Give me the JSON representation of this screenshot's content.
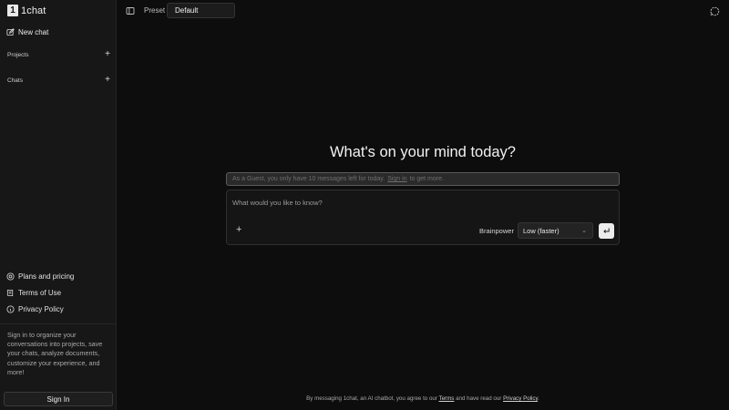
{
  "app": {
    "logo_mark": "1",
    "name": "1chat"
  },
  "sidebar": {
    "new_chat": "New chat",
    "sections": [
      {
        "label": "Projects",
        "add": "+"
      },
      {
        "label": "Chats",
        "add": "+"
      }
    ],
    "links": [
      {
        "label": "Plans and pricing",
        "icon": "pricing-icon"
      },
      {
        "label": "Terms of Use",
        "icon": "terms-icon"
      },
      {
        "label": "Privacy Policy",
        "icon": "privacy-icon"
      }
    ],
    "signin_blurb": "Sign in to organize your conversations into projects, save your chats, analyze documents, customize your experience, and more!",
    "signin_button": "Sign In"
  },
  "topbar": {
    "preset_label": "Preset",
    "preset_value": "Default"
  },
  "main": {
    "title": "What's on your mind today?",
    "guest_banner": {
      "prefix": "As a Guest, you only have 10 messages left for today.",
      "link": "Sign in",
      "suffix": "to get more."
    },
    "composer": {
      "placeholder": "What would you like to know?",
      "attach": "+",
      "brainpower_label": "Brainpower",
      "brainpower_value": "Low (faster)",
      "chevron": "⌄"
    },
    "footer": {
      "prefix": "By messaging 1chat, an AI chatbot, you agree to our",
      "terms": "Terms",
      "middle": "and have read our",
      "privacy": "Privacy Policy",
      "end": "."
    }
  },
  "colors": {
    "background": "#0d0d0d",
    "sidebar": "#171717",
    "accent_send": "#ececec"
  }
}
